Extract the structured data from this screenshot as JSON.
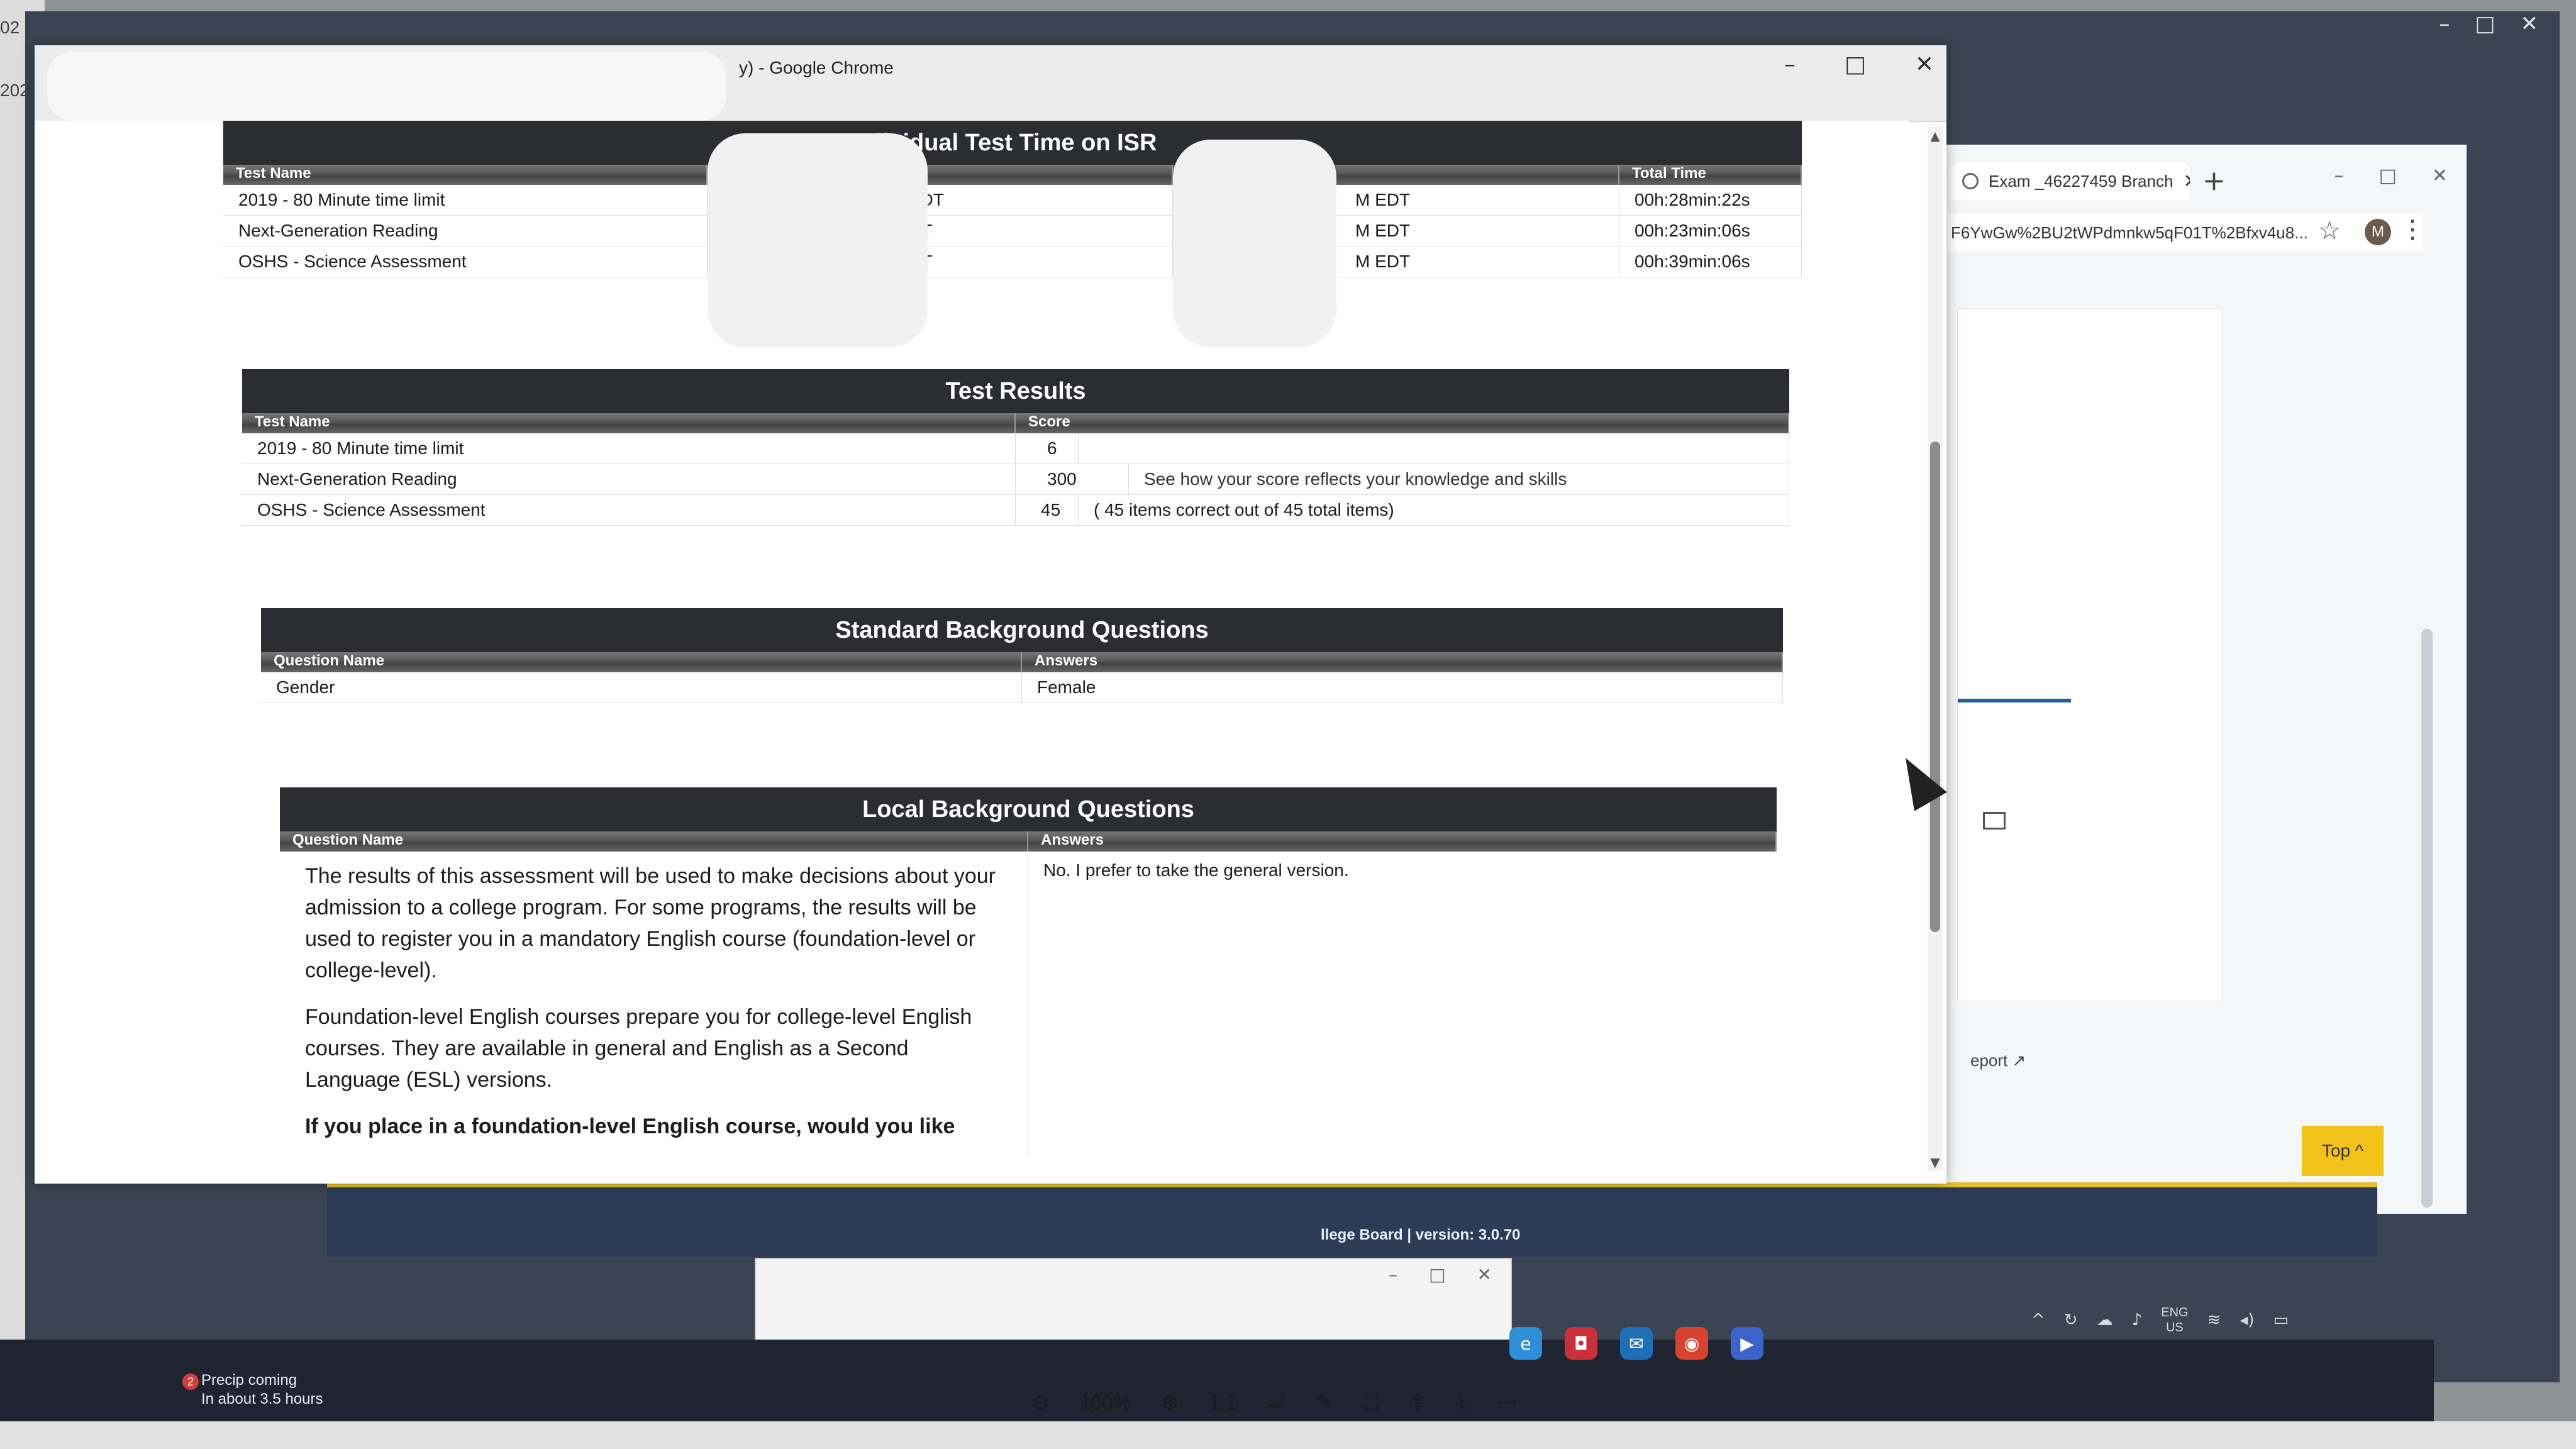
{
  "desktop": {
    "left_stubs": [
      "02",
      "202"
    ],
    "outer_controls": [
      "–",
      "□",
      "✕"
    ]
  },
  "background_window": {
    "tab_title": "Exam _46227459 Branch",
    "tab_close": "✕",
    "new_tab": "+",
    "controls": [
      "–",
      "□",
      "✕"
    ],
    "url_text": "F6YwGw%2BU2tWPdmnkw5qF01T%2Bfxv4u8...",
    "star": "☆",
    "avatar": "M",
    "menu": "⋮",
    "report_link": "eport ↗",
    "top_button": "Top ^",
    "footer_text": "llege Board | version: 3.0.70",
    "mini_controls": [
      "–",
      "□",
      "✕"
    ]
  },
  "main_window": {
    "title": "y) - Google Chrome",
    "controls": [
      "–",
      "□",
      "✕"
    ]
  },
  "sections": {
    "time": {
      "heading": "dividual Test Time on ISR",
      "col_test_name": "Test Name",
      "col_total_time": "Total Time",
      "rows": [
        {
          "name": "2019 - 80 Minute time limit",
          "start": "EDT",
          "end": "M EDT",
          "total": "00h:28min:22s"
        },
        {
          "name": "Next-Generation Reading",
          "start": "DT",
          "end": "M EDT",
          "total": "00h:23min:06s"
        },
        {
          "name": "OSHS - Science Assessment",
          "start": "DT",
          "end": "M EDT",
          "total": "00h:39min:06s"
        }
      ]
    },
    "results": {
      "heading": "Test Results",
      "col_test_name": "Test Name",
      "col_score": "Score",
      "rows": [
        {
          "name": "2019 - 80 Minute time limit",
          "score": "6",
          "note": ""
        },
        {
          "name": "Next-Generation Reading",
          "score": "300",
          "note": "See how your score reflects your knowledge and skills"
        },
        {
          "name": "OSHS - Science Assessment",
          "score": "45",
          "note": "( 45 items correct out of 45 total items)"
        }
      ]
    },
    "standard": {
      "heading": "Standard Background Questions",
      "col_question": "Question Name",
      "col_answers": "Answers",
      "rows": [
        {
          "question": "Gender",
          "answer": "Female"
        }
      ]
    },
    "local": {
      "heading": "Local Background Questions",
      "col_question": "Question Name",
      "col_answers": "Answers",
      "para1": "The results of this assessment will be used to make decisions about your admission to a college program. For some programs, the results will be used to register you in a mandatory English course (foundation-level or college-level).",
      "para2": "Foundation-level English courses prepare you for college-level English courses. They are available in general and English as a Second Language (ESL) versions.",
      "para3": "If you place in a foundation-level English course, would you like",
      "answer": "No. I prefer to take the general version."
    }
  },
  "taskbar": {
    "notification_badge": "2",
    "notification_title": "Precip coming",
    "notification_sub": "In about 3.5 hours",
    "zoom": "100%",
    "ratio_button": "1:1",
    "lang_top": "ENG",
    "lang_bottom": "US",
    "tray_up": "^"
  }
}
